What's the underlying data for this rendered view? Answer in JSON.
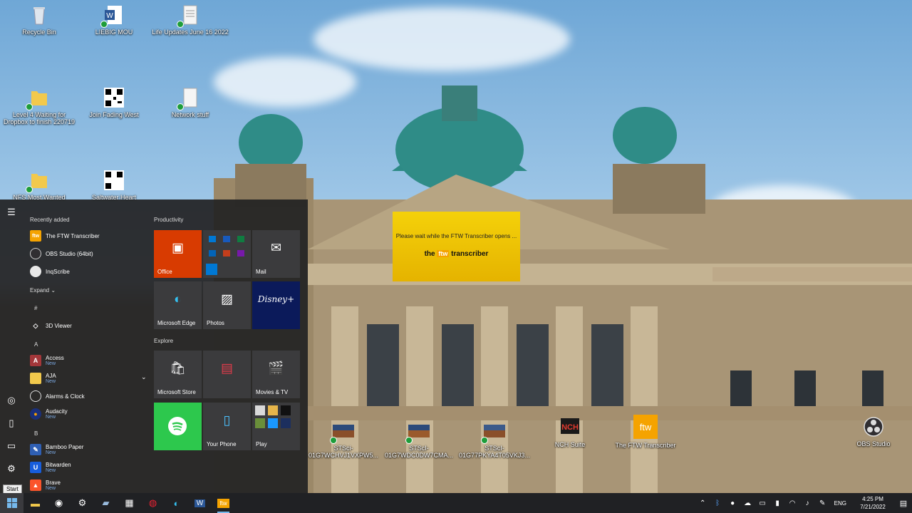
{
  "desktop": {
    "icons": [
      {
        "label": "Recycle Bin",
        "icon": "recycle-bin-icon"
      },
      {
        "label": "LIEBIG MOU",
        "icon": "word-document-icon"
      },
      {
        "label": "Life Updates June 16 2022",
        "icon": "text-document-icon"
      },
      {
        "label": "Level 4 Waiting for Dropbox to finish 220719",
        "icon": "folder-icon"
      },
      {
        "label": "Join Fading West",
        "icon": "qr-code-icon"
      },
      {
        "label": "Network stuff",
        "icon": "text-document-icon"
      },
      {
        "label": "NFS Most Wanted",
        "icon": "folder-icon"
      },
      {
        "label": "Saltwater Heart",
        "icon": "qr-code-icon"
      },
      {
        "label": "STSci-01G7WCHVJ1VXPW5...",
        "icon": "image-file-icon"
      },
      {
        "label": "STScI-01G7WDC0DW7CMA...",
        "icon": "image-file-icon"
      },
      {
        "label": "STScI-01G77PKYA4T05VKJ3...",
        "icon": "image-file-icon"
      },
      {
        "label": "NCH Suite",
        "icon": "nch-suite-icon"
      },
      {
        "label": "The FTW Transcriber",
        "icon": "ftw-icon"
      },
      {
        "label": "OBS Studio",
        "icon": "obs-icon"
      }
    ]
  },
  "popup": {
    "message": "Please wait while the FTW Transcriber opens ...",
    "brand_pre": "the",
    "brand_mark": "ftw",
    "brand_post": "transcriber"
  },
  "start_menu": {
    "recently_added_label": "Recently added",
    "recent": [
      {
        "name": "The FTW Transcriber",
        "icon": "ftw-icon"
      },
      {
        "name": "OBS Studio (64bit)",
        "icon": "obs-icon"
      },
      {
        "name": "InqScribe",
        "icon": "inqscribe-icon"
      }
    ],
    "expand_label": "Expand",
    "letters": [
      "#",
      "A",
      "B"
    ],
    "apps": [
      {
        "name": "3D Viewer",
        "badge": "",
        "icon": "3d-viewer-icon"
      },
      {
        "name": "Access",
        "badge": "New",
        "icon": "access-icon"
      },
      {
        "name": "AJA",
        "badge": "New",
        "icon": "folder-icon"
      },
      {
        "name": "Alarms & Clock",
        "badge": "",
        "icon": "alarm-clock-icon"
      },
      {
        "name": "Audacity",
        "badge": "New",
        "icon": "audacity-icon"
      },
      {
        "name": "Bamboo Paper",
        "badge": "New",
        "icon": "bamboo-paper-icon"
      },
      {
        "name": "Bitwarden",
        "badge": "New",
        "icon": "bitwarden-icon"
      },
      {
        "name": "Brave",
        "badge": "New",
        "icon": "brave-icon"
      }
    ],
    "groups": {
      "productivity": "Productivity",
      "explore": "Explore"
    },
    "tiles": {
      "office": "Office",
      "mail": "Mail",
      "edge": "Microsoft Edge",
      "photos": "Photos",
      "disney": "Disney+",
      "store": "Microsoft Store",
      "movies": "Movies & TV",
      "phone": "Your Phone",
      "play": "Play"
    },
    "start_tooltip": "Start"
  },
  "taskbar": {
    "language": "ENG",
    "time": "4:25 PM",
    "date": "7/21/2022",
    "ftw_label": "ftw"
  }
}
